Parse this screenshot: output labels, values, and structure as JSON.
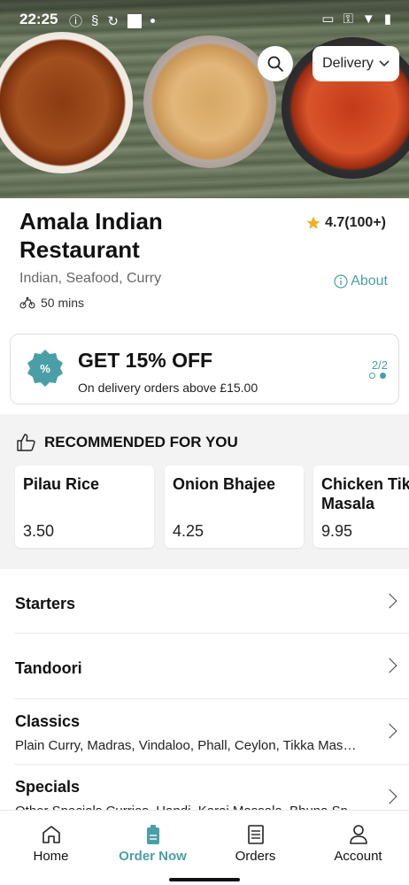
{
  "status_bar": {
    "time": "22:25"
  },
  "hero": {
    "search_icon": "search-icon",
    "delivery_label": "Delivery"
  },
  "restaurant": {
    "name": "Amala Indian Restaurant",
    "rating": "4.7(100+)",
    "cuisines": "Indian, Seafood, Curry",
    "about_label": "About",
    "eta": "50 mins"
  },
  "offer": {
    "title": "GET 15% OFF",
    "subtitle": "On delivery orders above £15.00",
    "page": "2/2"
  },
  "recommended": {
    "heading": "RECOMMENDED FOR YOU",
    "items": [
      {
        "name": "Pilau Rice",
        "price": "3.50"
      },
      {
        "name": "Onion Bhajee",
        "price": "4.25"
      },
      {
        "name": "Chicken Tikka Masala",
        "price": "9.95"
      }
    ]
  },
  "categories": [
    {
      "title": "Starters",
      "subtitle": ""
    },
    {
      "title": "Tandoori",
      "subtitle": ""
    },
    {
      "title": "Classics",
      "subtitle": "Plain Curry, Madras, Vindaloo, Phall, Ceylon, Tikka Masala, Korma"
    },
    {
      "title": "Specials",
      "subtitle": "Other Specials Curries, Handi, Karai Massala, Bhuna Specials"
    }
  ],
  "nav": {
    "items": [
      {
        "label": "Home"
      },
      {
        "label": "Order Now"
      },
      {
        "label": "Orders"
      },
      {
        "label": "Account"
      }
    ]
  },
  "colors": {
    "accent": "#4a9fa6",
    "star": "#f2b01e"
  }
}
